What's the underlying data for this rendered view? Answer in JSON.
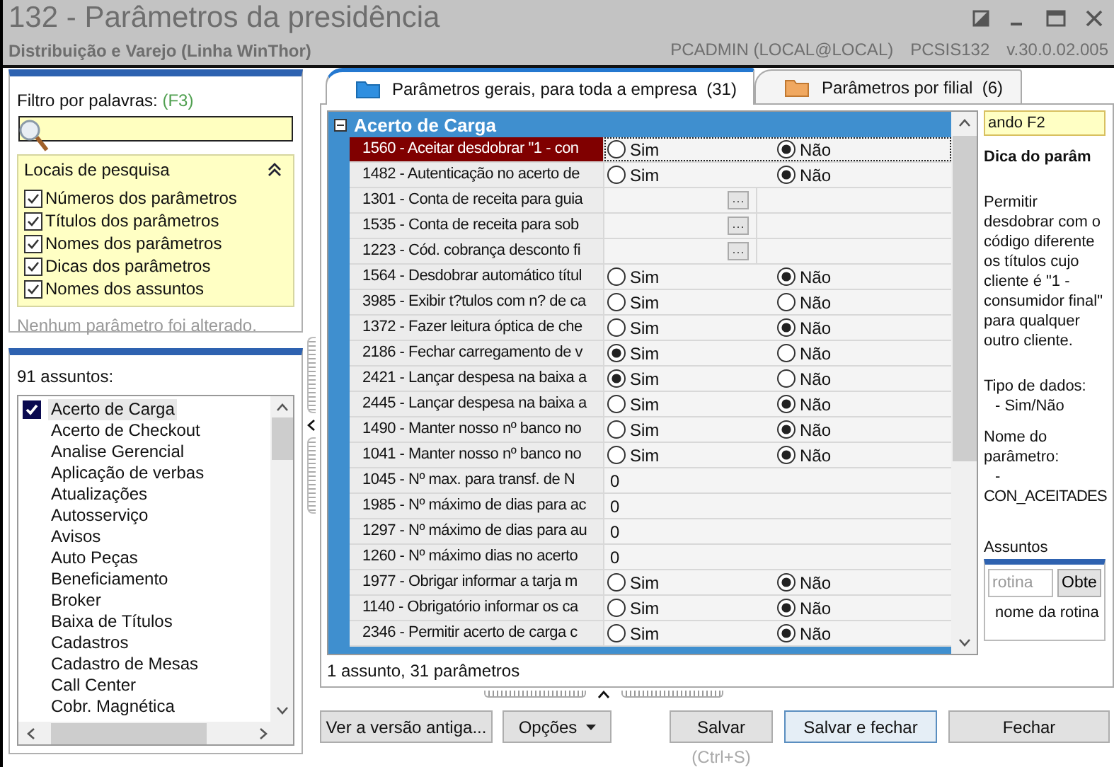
{
  "window": {
    "title": "132 - Parâmetros da presidência",
    "subtitle": "Distribuição e Varejo (Linha WinThor)",
    "user": "PCADMIN (LOCAL@LOCAL)",
    "program": "PCSIS132",
    "version": "v.30.0.02.005"
  },
  "filter": {
    "label": "Filtro por palavras:",
    "shortcut": "(F3)",
    "locations_title": "Locais de pesquisa",
    "locations": [
      {
        "label": "Números dos parâmetros",
        "checked": true
      },
      {
        "label": "Títulos dos parâmetros",
        "checked": true
      },
      {
        "label": "Nomes dos parâmetros",
        "checked": true
      },
      {
        "label": "Dicas dos parâmetros",
        "checked": true
      },
      {
        "label": "Nomes dos assuntos",
        "checked": true
      }
    ],
    "status": "Nenhum parâmetro foi alterado."
  },
  "subjects": {
    "count_label": "91 assuntos:",
    "items": [
      {
        "label": "Acerto de Carga",
        "selected": true
      },
      {
        "label": "Acerto de Checkout",
        "selected": false
      },
      {
        "label": "Analise Gerencial",
        "selected": false
      },
      {
        "label": "Aplicação de verbas",
        "selected": false
      },
      {
        "label": "Atualizações",
        "selected": false
      },
      {
        "label": "Autosserviço",
        "selected": false
      },
      {
        "label": "Avisos",
        "selected": false
      },
      {
        "label": "Auto Peças",
        "selected": false
      },
      {
        "label": "Beneficiamento",
        "selected": false
      },
      {
        "label": "Broker",
        "selected": false
      },
      {
        "label": "Baixa de Títulos",
        "selected": false
      },
      {
        "label": "Cadastros",
        "selected": false
      },
      {
        "label": "Cadastro de Mesas",
        "selected": false
      },
      {
        "label": "Call Center",
        "selected": false
      },
      {
        "label": "Cobr. Magnética",
        "selected": false
      }
    ]
  },
  "tabs": [
    {
      "label": "Parâmetros gerais, para toda a empresa",
      "count": "(31)",
      "selected": true
    },
    {
      "label": "Parâmetros por filial",
      "count": "(6)",
      "selected": false
    }
  ],
  "grid": {
    "group": "Acerto de Carga",
    "footer": "1 assunto, 31 parâmetros",
    "rows": [
      {
        "kind": "radio",
        "label": "1560 - Aceitar desdobrar \"1 - con",
        "selected": true,
        "options": [
          {
            "label": "Sim",
            "selected": false
          },
          {
            "label": "Não",
            "selected": true
          }
        ]
      },
      {
        "kind": "radio",
        "label": "1482 - Autenticação no acerto de",
        "selected": false,
        "options": [
          {
            "label": "Sim",
            "selected": false
          },
          {
            "label": "Não",
            "selected": true
          }
        ]
      },
      {
        "kind": "lookup",
        "label": "1301 - Conta de receita para guia",
        "selected": false,
        "button": "···"
      },
      {
        "kind": "lookup",
        "label": "1535 - Conta de receita para sob",
        "selected": false,
        "button": "···"
      },
      {
        "kind": "lookup",
        "label": "1223 - Cód. cobrança desconto fi",
        "selected": false,
        "button": "···"
      },
      {
        "kind": "radio",
        "label": "1564 - Desdobrar automático títul",
        "selected": false,
        "options": [
          {
            "label": "Sim",
            "selected": false
          },
          {
            "label": "Não",
            "selected": true
          }
        ]
      },
      {
        "kind": "radio",
        "label": "3985 - Exibir t?tulos com n? de ca",
        "selected": false,
        "options": [
          {
            "label": "Sim",
            "selected": false
          },
          {
            "label": "Não",
            "selected": false
          }
        ]
      },
      {
        "kind": "radio",
        "label": "1372 - Fazer leitura óptica de che",
        "selected": false,
        "options": [
          {
            "label": "Sim",
            "selected": false
          },
          {
            "label": "Não",
            "selected": true
          }
        ]
      },
      {
        "kind": "radio",
        "label": "2186 - Fechar carregamento de v",
        "selected": false,
        "options": [
          {
            "label": "Sim",
            "selected": true
          },
          {
            "label": "Não",
            "selected": false
          }
        ]
      },
      {
        "kind": "radio",
        "label": "2421 - Lançar despesa na baixa a",
        "selected": false,
        "options": [
          {
            "label": "Sim",
            "selected": true
          },
          {
            "label": "Não",
            "selected": false
          }
        ]
      },
      {
        "kind": "radio",
        "label": "2445 - Lançar despesa na baixa a",
        "selected": false,
        "options": [
          {
            "label": "Sim",
            "selected": false
          },
          {
            "label": "Não",
            "selected": true
          }
        ]
      },
      {
        "kind": "radio",
        "label": "1490 - Manter nosso nº banco no",
        "selected": false,
        "options": [
          {
            "label": "Sim",
            "selected": false
          },
          {
            "label": "Não",
            "selected": true
          }
        ]
      },
      {
        "kind": "radio",
        "label": "1041 - Manter nosso nº banco no",
        "selected": false,
        "options": [
          {
            "label": "Sim",
            "selected": false
          },
          {
            "label": "Não",
            "selected": true
          }
        ]
      },
      {
        "kind": "number",
        "label": "1045 - Nº max. para transf. de N",
        "selected": false,
        "value": "0"
      },
      {
        "kind": "number",
        "label": "1985 - Nº máximo de dias para ac",
        "selected": false,
        "value": "0"
      },
      {
        "kind": "number",
        "label": "1297 - Nº máximo de dias para au",
        "selected": false,
        "value": "0"
      },
      {
        "kind": "number",
        "label": "1260 - Nº máximo dias no acerto",
        "selected": false,
        "value": "0"
      },
      {
        "kind": "radio",
        "label": "1977 - Obrigar informar a tarja m",
        "selected": false,
        "options": [
          {
            "label": "Sim",
            "selected": false
          },
          {
            "label": "Não",
            "selected": true
          }
        ]
      },
      {
        "kind": "radio",
        "label": "1140 - Obrigatório informar os ca",
        "selected": false,
        "options": [
          {
            "label": "Sim",
            "selected": false
          },
          {
            "label": "Não",
            "selected": true
          }
        ]
      },
      {
        "kind": "radio",
        "label": "2346 - Permitir acerto de carga c",
        "selected": false,
        "options": [
          {
            "label": "Sim",
            "selected": false
          },
          {
            "label": "Não",
            "selected": true
          }
        ]
      }
    ]
  },
  "tip_panel": {
    "search_value": "ando F2",
    "title": "Dica do parâm",
    "description": "Permitir desdobrar com o código diferente os títulos cujo cliente é \"1 - consumidor final\" para qualquer outro cliente.",
    "data_type_label": "Tipo de dados:",
    "data_type": "- Sim/Não",
    "name_label": "Nome do parâmetro:",
    "name_dash": "-",
    "name": "CON_ACEITADES",
    "subjects_label": "Assuntos",
    "routine_placeholder": "rotina",
    "routine_button": "Obte",
    "routine_hint": "nome da rotina"
  },
  "buttons": [
    {
      "kind": "plain",
      "label": "Ver a versão antiga...",
      "focused": false
    },
    {
      "kind": "dropdown",
      "label": "Opções",
      "focused": false
    },
    {
      "kind": "hint",
      "label": "Salvar",
      "hint": "(Ctrl+S)",
      "focused": false
    },
    {
      "kind": "plain",
      "label": "Salvar e fechar",
      "focused": true
    },
    {
      "kind": "plain",
      "label": "Fechar",
      "focused": false
    }
  ]
}
